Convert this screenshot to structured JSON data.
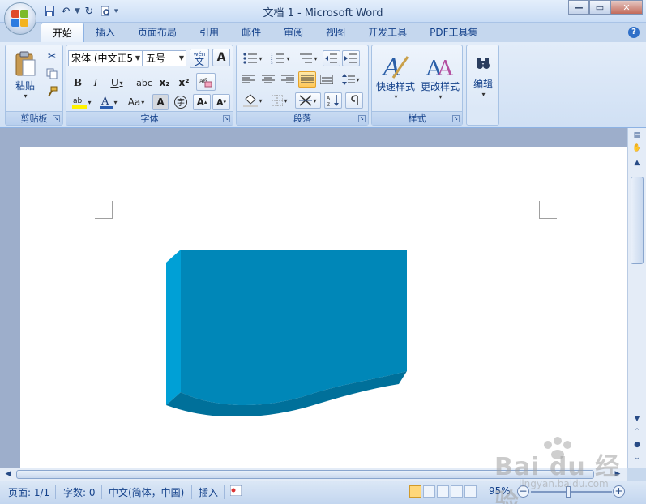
{
  "window": {
    "title": "文档 1 - Microsoft Word"
  },
  "tabs": [
    {
      "label": "开始",
      "active": true
    },
    {
      "label": "插入"
    },
    {
      "label": "页面布局"
    },
    {
      "label": "引用"
    },
    {
      "label": "邮件"
    },
    {
      "label": "审阅"
    },
    {
      "label": "视图"
    },
    {
      "label": "开发工具"
    },
    {
      "label": "PDF工具集"
    }
  ],
  "ribbon": {
    "clipboard": {
      "label": "剪贴板",
      "paste": "粘贴"
    },
    "font": {
      "label": "字体",
      "font_name": "宋体 (中文正5",
      "font_size": "五号",
      "bold": "B",
      "italic": "I",
      "underline": "U",
      "strike": "abc",
      "subscript": "x₂",
      "superscript": "x²",
      "grow": "A",
      "shrink": "A",
      "case": "Aa",
      "phonetic": "wén",
      "phonetic_char": "文",
      "border_char": "A",
      "enclose_char": "字"
    },
    "paragraph": {
      "label": "段落"
    },
    "styles": {
      "label": "样式",
      "quick_styles": "快速样式",
      "change_styles": "更改样式"
    },
    "editing": {
      "label": "编辑"
    }
  },
  "status": {
    "page": "页面: 1/1",
    "words": "字数: 0",
    "language": "中文(简体，中国)",
    "mode": "插入",
    "zoom": "95%"
  },
  "shape": {
    "type": "3D wave-bottom block",
    "fill": "#0087b8",
    "side_fill": "#00a0d6",
    "bottom_fill": "#00709a"
  },
  "watermark": {
    "text": "Bai du 经验",
    "url": "jingyan.baidu.com"
  }
}
